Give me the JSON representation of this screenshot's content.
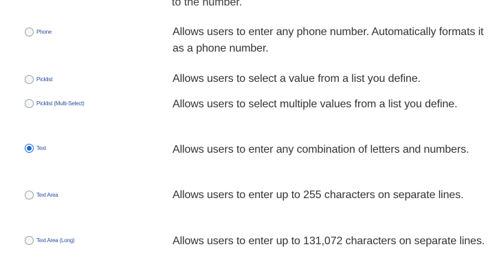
{
  "top_fragment": "to the number.",
  "field_types": [
    {
      "label": "Phone",
      "selected": false,
      "description": "Allows users to enter any phone number. Automatically formats it as a phone number."
    },
    {
      "label": "Picklist",
      "selected": false,
      "description": "Allows users to select a value from a list you define."
    },
    {
      "label": "Picklist (Multi-Select)",
      "selected": false,
      "description": "Allows users to select multiple values from a list you define."
    },
    {
      "label": "Text",
      "selected": true,
      "description": "Allows users to enter any combination of letters and numbers."
    },
    {
      "label": "Text Area",
      "selected": false,
      "description": "Allows users to enter up to 255 characters on separate lines."
    },
    {
      "label": "Text Area (Long)",
      "selected": false,
      "description": "Allows users to enter up to 131,072 characters on separate lines."
    }
  ],
  "colors": {
    "radio_selected": "#1a66d6",
    "label_text": "#2a4f9e",
    "description_text": "#333333"
  }
}
